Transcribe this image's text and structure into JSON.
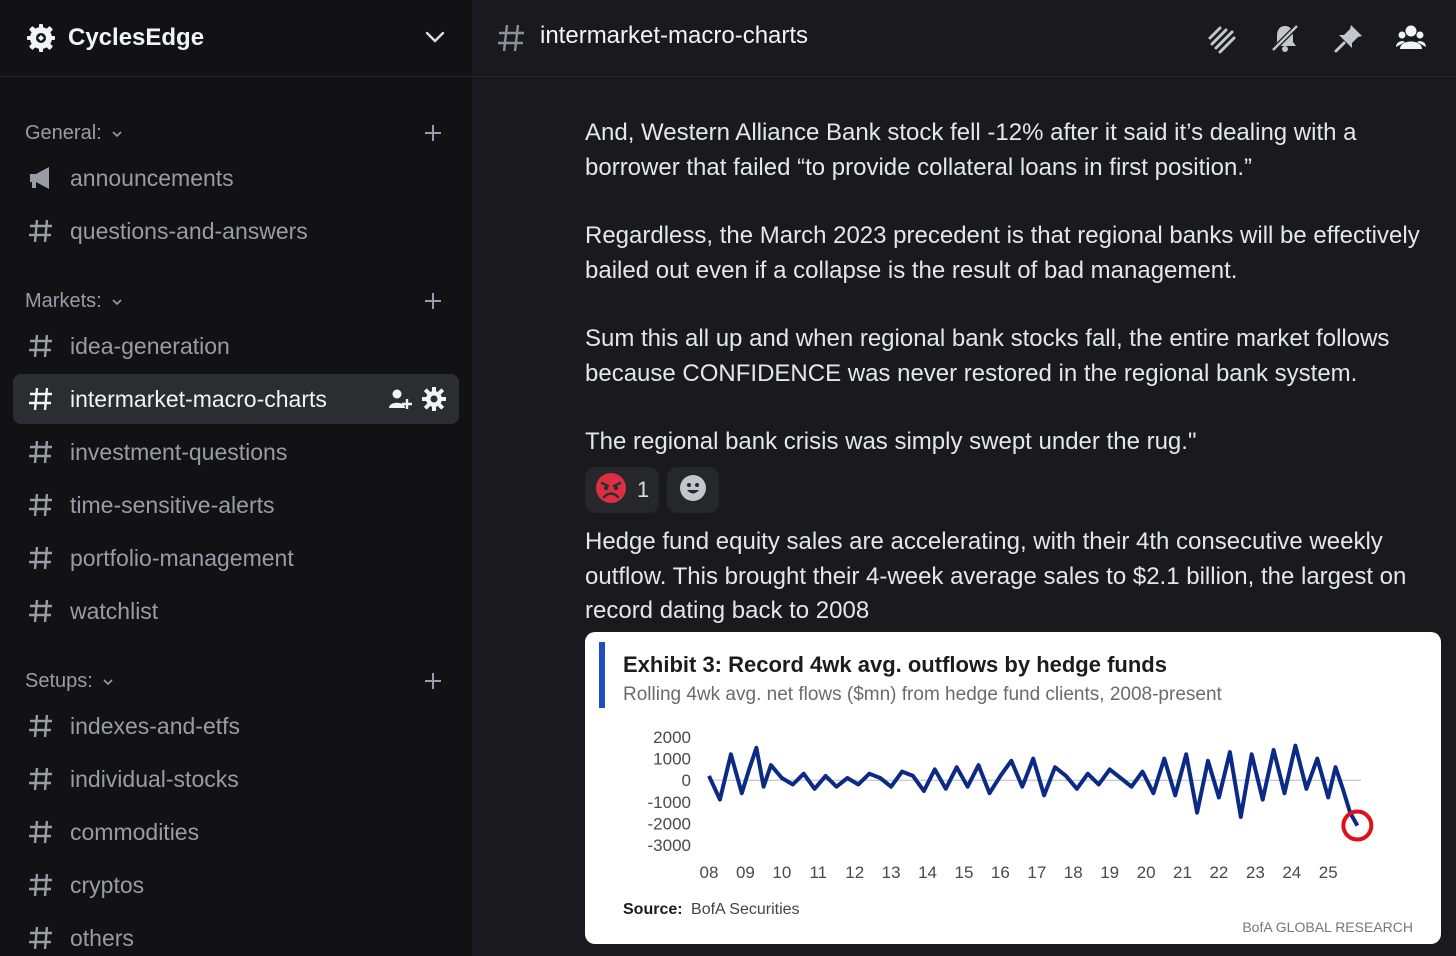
{
  "server": {
    "name": "CyclesEdge",
    "logo_icon": "server-logo-icon"
  },
  "sidebar": {
    "categories": [
      {
        "label": "General:",
        "channels": [
          {
            "label": "announcements",
            "icon": "megaphone-icon"
          },
          {
            "label": "questions-and-answers",
            "icon": "hash-icon"
          }
        ]
      },
      {
        "label": "Markets:",
        "channels": [
          {
            "label": "idea-generation",
            "icon": "hash-icon"
          },
          {
            "label": "intermarket-macro-charts",
            "icon": "hash-icon",
            "active": true
          },
          {
            "label": "investment-questions",
            "icon": "hash-icon"
          },
          {
            "label": "time-sensitive-alerts",
            "icon": "hash-icon"
          },
          {
            "label": "portfolio-management",
            "icon": "hash-icon"
          },
          {
            "label": "watchlist",
            "icon": "hash-icon"
          }
        ]
      },
      {
        "label": "Setups:",
        "channels": [
          {
            "label": "indexes-and-etfs",
            "icon": "hash-icon"
          },
          {
            "label": "individual-stocks",
            "icon": "hash-icon"
          },
          {
            "label": "commodities",
            "icon": "hash-icon"
          },
          {
            "label": "cryptos",
            "icon": "hash-icon"
          },
          {
            "label": "others",
            "icon": "hash-icon"
          }
        ]
      }
    ]
  },
  "topbar": {
    "channel_name": "intermarket-macro-charts",
    "icons": [
      "threads-icon",
      "mute-bell-icon",
      "pin-icon",
      "members-icon"
    ]
  },
  "messages": {
    "paragraphs": [
      "And, Western Alliance Bank stock fell -12% after it said it’s dealing with a borrower that failed “to provide collateral loans in first position.”",
      "Regardless, the March 2023 precedent is that regional banks will be effectively bailed out even if a collapse is the result of bad management.",
      "Sum this all up and when regional bank stocks fall, the entire market follows because CONFIDENCE was never restored in the regional bank system.",
      "The regional bank crisis was simply swept under the rug.\""
    ],
    "reactions": [
      {
        "emoji": "angry-face-icon",
        "count": "1"
      },
      {
        "emoji": "add-reaction-icon",
        "count": ""
      }
    ],
    "second_message": "Hedge fund equity sales are accelerating, with their 4th consecutive weekly outflow. This brought their 4-week average sales to $2.1 billion, the largest on record dating back to 2008"
  },
  "colors": {
    "sidebar_bg": "#121214",
    "main_bg": "#1a1a1e",
    "active_channel_bg": "#2c2d31",
    "chart_line": "#0b2a86",
    "chart_accent_bar": "#1f4fbf",
    "highlight_circle": "#e0101a",
    "angry_emoji": "#dd2e44"
  },
  "chart_data": {
    "type": "line",
    "title": "Exhibit 3: Record 4wk avg. outflows by hedge funds",
    "subtitle": "Rolling 4wk avg. net flows ($mn) from hedge fund clients, 2008-present",
    "source_label": "Source:",
    "source": "BofA Securities",
    "footer": "BofA GLOBAL RESEARCH",
    "y_ticks": [
      "2000",
      "1000",
      "0",
      "-1000",
      "-2000",
      "-3000"
    ],
    "x_ticks": [
      "08",
      "09",
      "10",
      "11",
      "12",
      "13",
      "14",
      "15",
      "16",
      "17",
      "18",
      "19",
      "20",
      "21",
      "22",
      "23",
      "24",
      "25"
    ],
    "ylim": [
      -3000,
      2000
    ],
    "xlim": [
      2008,
      2025.9
    ],
    "series": [
      {
        "x": [
          2008.0,
          2008.3,
          2008.6,
          2008.9,
          2009.1,
          2009.3,
          2009.5,
          2009.7,
          2010.0,
          2010.3,
          2010.6,
          2010.9,
          2011.2,
          2011.5,
          2011.8,
          2012.1,
          2012.4,
          2012.7,
          2013.0,
          2013.3,
          2013.6,
          2013.9,
          2014.2,
          2014.5,
          2014.8,
          2015.1,
          2015.4,
          2015.7,
          2016.0,
          2016.3,
          2016.6,
          2016.9,
          2017.2,
          2017.5,
          2017.8,
          2018.1,
          2018.4,
          2018.7,
          2019.0,
          2019.3,
          2019.6,
          2019.9,
          2020.2,
          2020.5,
          2020.8,
          2021.1,
          2021.4,
          2021.7,
          2022.0,
          2022.3,
          2022.6,
          2022.9,
          2023.2,
          2023.5,
          2023.8,
          2024.1,
          2024.4,
          2024.7,
          2025.0,
          2025.2,
          2025.4,
          2025.6,
          2025.8
        ],
        "y": [
          200,
          -900,
          1200,
          -600,
          500,
          1500,
          -300,
          700,
          100,
          -200,
          300,
          -400,
          200,
          -300,
          100,
          -200,
          300,
          100,
          -300,
          400,
          200,
          -500,
          500,
          -400,
          600,
          -300,
          700,
          -600,
          200,
          900,
          -300,
          1000,
          -700,
          600,
          200,
          -400,
          300,
          -200,
          500,
          100,
          -300,
          400,
          -600,
          1000,
          -700,
          1200,
          -1500,
          900,
          -800,
          1300,
          -1700,
          1200,
          -900,
          1400,
          -600,
          1600,
          -400,
          1000,
          -800,
          600,
          -400,
          -1500,
          -2100
        ]
      }
    ],
    "highlight": {
      "x": 2025.8,
      "y": -2100
    }
  }
}
